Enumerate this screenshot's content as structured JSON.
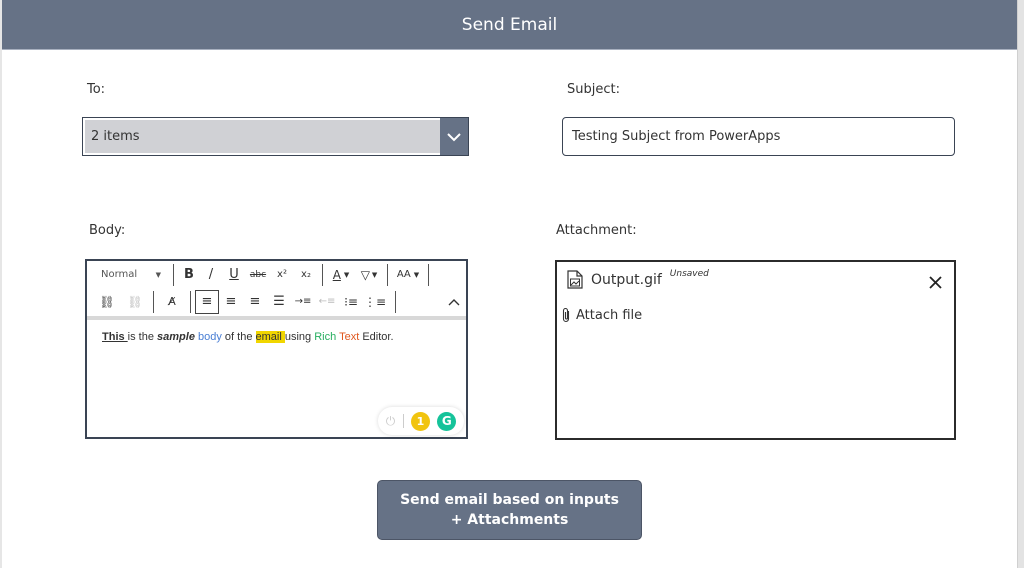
{
  "header": {
    "title": "Send Email"
  },
  "to": {
    "label": "To:",
    "value": "2 items",
    "chevron_icon": "chevron-down"
  },
  "subject": {
    "label": "Subject:",
    "value": "Testing Subject from PowerApps"
  },
  "body": {
    "label": "Body:",
    "toolbar": {
      "format_select": "Normal",
      "bold": "B",
      "italic": "I",
      "underline": "U",
      "strikethrough": "abc",
      "superscript": "x²",
      "subscript": "x₂",
      "font_color": "A",
      "highlight": "highlight",
      "font_size": "AA",
      "link": "link",
      "unlink": "unlink",
      "clear_format": "clear-format",
      "align_left": "align-left",
      "align_center": "align-center",
      "align_right": "align-right",
      "align_justify": "align-justify",
      "indent": "indent",
      "outdent": "outdent",
      "bullet_list": "bullet-list",
      "numbered_list": "numbered-list",
      "collapse": "collapse"
    },
    "content": {
      "part1": "This ",
      "part2": "is the ",
      "part3": "sample",
      "part4": " ",
      "part5": "body",
      "part6": " of the ",
      "part7": "email ",
      "part8": "using ",
      "part9": "Rich",
      "part10": " ",
      "part11": "Text",
      "part12": " Editor."
    },
    "colors": {
      "body_word": "#4a7fd4",
      "highlight": "#f1d600",
      "rich_word": "#27ae60",
      "text_word": "#e0581f"
    },
    "grammarly": {
      "issue_count": "1",
      "logo": "G"
    }
  },
  "attachment": {
    "label": "Attachment:",
    "files": [
      {
        "name": "Output.gif",
        "status": "Unsaved"
      }
    ],
    "attach_link": "Attach file"
  },
  "send_button": {
    "label": "Send email based on inputs + Attachments"
  },
  "theme": {
    "primary": "#667286",
    "border": "#3a4454"
  }
}
